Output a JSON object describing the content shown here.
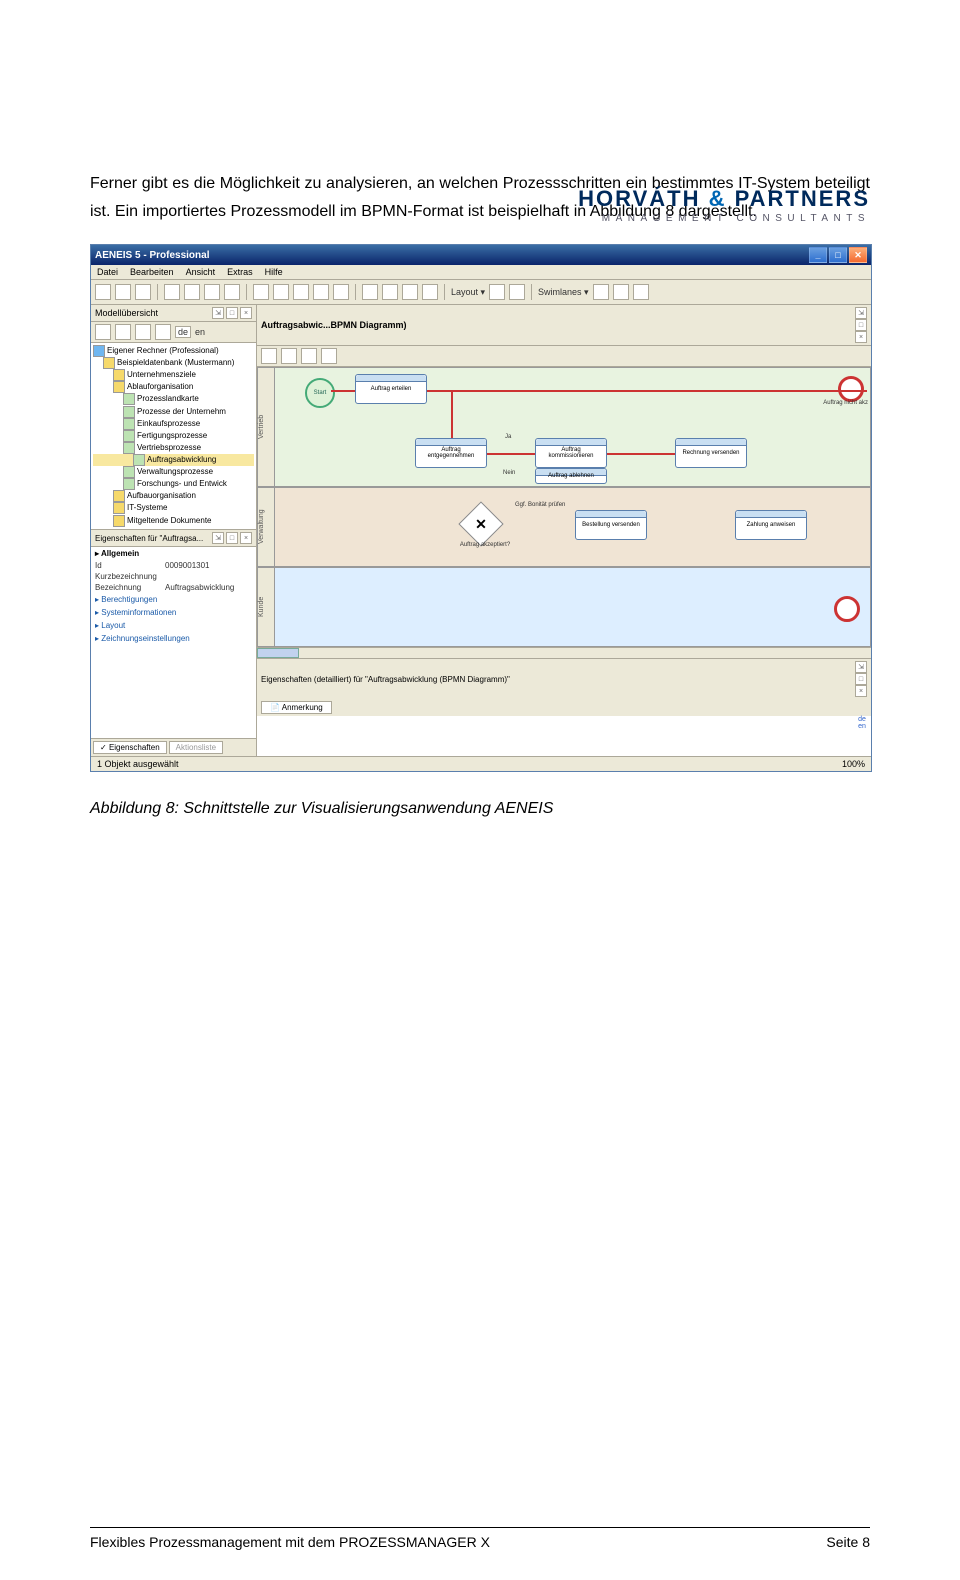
{
  "brand": {
    "name_a": "HORVÁTH ",
    "amp": "&",
    "name_b": " PARTNERS",
    "sub": "MANAGEMENT CONSULTANTS"
  },
  "paragraph": "Ferner gibt es die Möglichkeit zu analysieren, an welchen Prozessschritten ein bestimmtes IT-System beteiligt ist. Ein importiertes Prozessmodell im BPMN-Format ist beispielhaft in Abbildung 8 dargestellt.",
  "caption": "Abbildung 8: Schnittstelle zur Visualisierungsanwendung AENEIS",
  "footer": {
    "left": "Flexibles Prozessmanagement mit dem PROZESSMANAGER X",
    "right": "Seite 8"
  },
  "app": {
    "title": "AENEIS 5 - Professional",
    "menu": [
      "Datei",
      "Bearbeiten",
      "Ansicht",
      "Extras",
      "Hilfe"
    ],
    "toolbar_labels": {
      "layout": "Layout ▾",
      "swimlanes": "Swimlanes ▾"
    },
    "sidebar": {
      "header": "Modellübersicht",
      "tree": [
        {
          "lvl": 0,
          "ic": "blue",
          "txt": "Eigener Rechner (Professional)"
        },
        {
          "lvl": 1,
          "ic": "",
          "txt": "Beispieldatenbank (Mustermann)"
        },
        {
          "lvl": 2,
          "ic": "",
          "txt": "Unternehmensziele"
        },
        {
          "lvl": 2,
          "ic": "",
          "txt": "Ablauforganisation"
        },
        {
          "lvl": 3,
          "ic": "proc",
          "txt": "Prozesslandkarte"
        },
        {
          "lvl": 3,
          "ic": "proc",
          "txt": "Prozesse der Unternehm"
        },
        {
          "lvl": 3,
          "ic": "proc",
          "txt": "Einkaufsprozesse"
        },
        {
          "lvl": 3,
          "ic": "proc",
          "txt": "Fertigungsprozesse"
        },
        {
          "lvl": 3,
          "ic": "proc",
          "txt": "Vertriebsprozesse"
        },
        {
          "lvl": 4,
          "ic": "proc",
          "txt": "Auftragsabwicklung",
          "sel": true
        },
        {
          "lvl": 3,
          "ic": "proc",
          "txt": "Verwaltungsprozesse"
        },
        {
          "lvl": 3,
          "ic": "proc",
          "txt": "Forschungs- und Entwick"
        },
        {
          "lvl": 2,
          "ic": "",
          "txt": "Aufbauorganisation"
        },
        {
          "lvl": 2,
          "ic": "",
          "txt": "IT-Systeme"
        },
        {
          "lvl": 2,
          "ic": "",
          "txt": "Mitgeltende Dokumente"
        }
      ],
      "properties": {
        "header": "Eigenschaften für \"Auftragsa...",
        "group": "Allgemein",
        "rows": [
          {
            "k": "Id",
            "v": "0009001301"
          },
          {
            "k": "Kurzbezeichnung",
            "v": ""
          },
          {
            "k": "Bezeichnung",
            "v": "Auftragsabwicklung"
          }
        ],
        "extra": [
          "Berechtigungen",
          "Systeminformationen",
          "Layout",
          "Zeichnungseinstellungen"
        ]
      },
      "tabs": {
        "a": "Eigenschaften",
        "b": "Aktionsliste"
      }
    },
    "canvas": {
      "tab_title": "Auftragsabwic...BPMN Diagramm)",
      "lane_labels": [
        "Vertrieb",
        "Verwaltung",
        "Kunde"
      ],
      "nodes": {
        "start": "Start",
        "t_erteilen": "Auftrag erteilen",
        "t_entgegen": "Auftrag entgegennehmen",
        "t_komm": "Auftrag kommissionieren",
        "t_ablehnen": "Auftrag ablehnen",
        "t_rechnung": "Rechnung versenden",
        "t_bonitaet": "Ggf. Bonität prüfen",
        "t_bestellung": "Bestellung versenden",
        "t_zahlung": "Zahlung anweisen",
        "gateway_label": "Auftrag akzeptiert?",
        "lbl_ja": "Ja",
        "lbl_nein": "Nein",
        "end_label": "Auftrag nicht akz"
      },
      "detail_header": "Eigenschaften (detailliert) für \"Auftragsabwicklung (BPMN Diagramm)\"",
      "detail_tab": "Anmerkung",
      "side_hints": [
        "de",
        "en"
      ]
    },
    "status": {
      "left": "1 Objekt ausgewählt",
      "right": "100%"
    }
  }
}
